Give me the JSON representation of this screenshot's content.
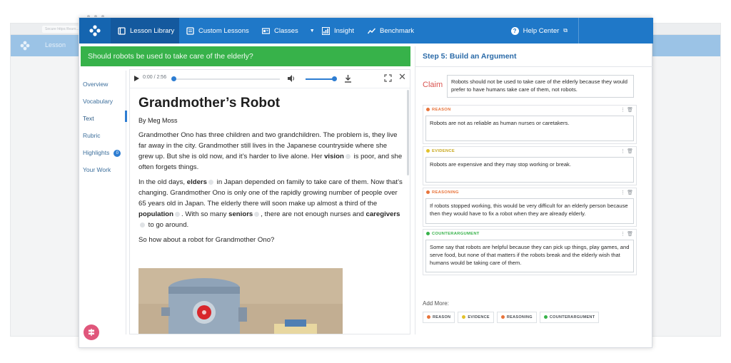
{
  "background": {
    "url": "Secure https://learn...",
    "tab_label": "Lesson"
  },
  "nav": {
    "items": [
      {
        "label": "Lesson Library",
        "icon": "book-icon"
      },
      {
        "label": "Custom Lessons",
        "icon": "document-icon"
      },
      {
        "label": "Classes",
        "icon": "classes-icon"
      },
      {
        "label": "Insight",
        "icon": "bar-chart-icon"
      },
      {
        "label": "Benchmark",
        "icon": "trend-icon"
      }
    ],
    "help_label": "Help Center"
  },
  "question": "Should robots be used to take care of the elderly?",
  "sidebar": {
    "items": [
      "Overview",
      "Vocabulary",
      "Text",
      "Rubric",
      "Highlights",
      "Your Work"
    ],
    "highlights_count": "0"
  },
  "player": {
    "time": "0:00 / 2:56"
  },
  "article": {
    "title": "Grandmother’s Robot",
    "byline": "By Meg Moss",
    "p1": "Grandmother Ono has three children and two grandchildren. The problem is, they live far away in the city. Grandmother still lives in the Japanese countryside where she grew up. But she is old now, and it’s harder to live alone. Her ",
    "p1_word": "vision",
    "p1_end": " is poor, and she often forgets things.",
    "p2_a": "In the old days, ",
    "p2_w1": "elders",
    "p2_b": " in Japan depended on family to take care of them. Now that’s changing. Grandmother Ono is only one of the rapidly growing number of people over 65 years old in Japan. The elderly there will soon make up almost a third of the ",
    "p2_w2": "population",
    "p2_c": ". With so many ",
    "p2_w3": "seniors",
    "p2_d": ", there are not enough nurses and ",
    "p2_w4": "caregivers",
    "p2_e": " to go around.",
    "p3": "So how about a robot for Grandmother Ono?"
  },
  "panel": {
    "step_title": "Step 5: Build an Argument",
    "claim_label": "Claim",
    "claim_text": "Robots should not be used to take care of the elderly because they would prefer to have humans take care of them, not robots.",
    "cards": [
      {
        "tag": "REASON",
        "color": "#e8743b",
        "text": "Robots are not as reliable as human nurses or caretakers."
      },
      {
        "tag": "EVIDENCE",
        "color": "#e2c12a",
        "text": "Robots are expensive and they may stop working or break."
      },
      {
        "tag": "REASONING",
        "color": "#e8743b",
        "text": "If robots stopped working, this would be very difficult for an elderly person because then they would have to fix a robot when they are already elderly."
      },
      {
        "tag": "COUNTERARGUMENT",
        "color": "#37b24a",
        "text": "Some say that robots are helpful because they can pick up things, play games, and serve food, but none of that matters if the robots break and the elderly wish that humans would be taking care of them."
      }
    ],
    "add_more": "Add More:",
    "chips": [
      {
        "label": "REASON",
        "color": "#e8743b"
      },
      {
        "label": "EVIDENCE",
        "color": "#e2c12a"
      },
      {
        "label": "REASONING",
        "color": "#e8743b"
      },
      {
        "label": "COUNTERARGUMENT",
        "color": "#37b24a"
      }
    ]
  }
}
